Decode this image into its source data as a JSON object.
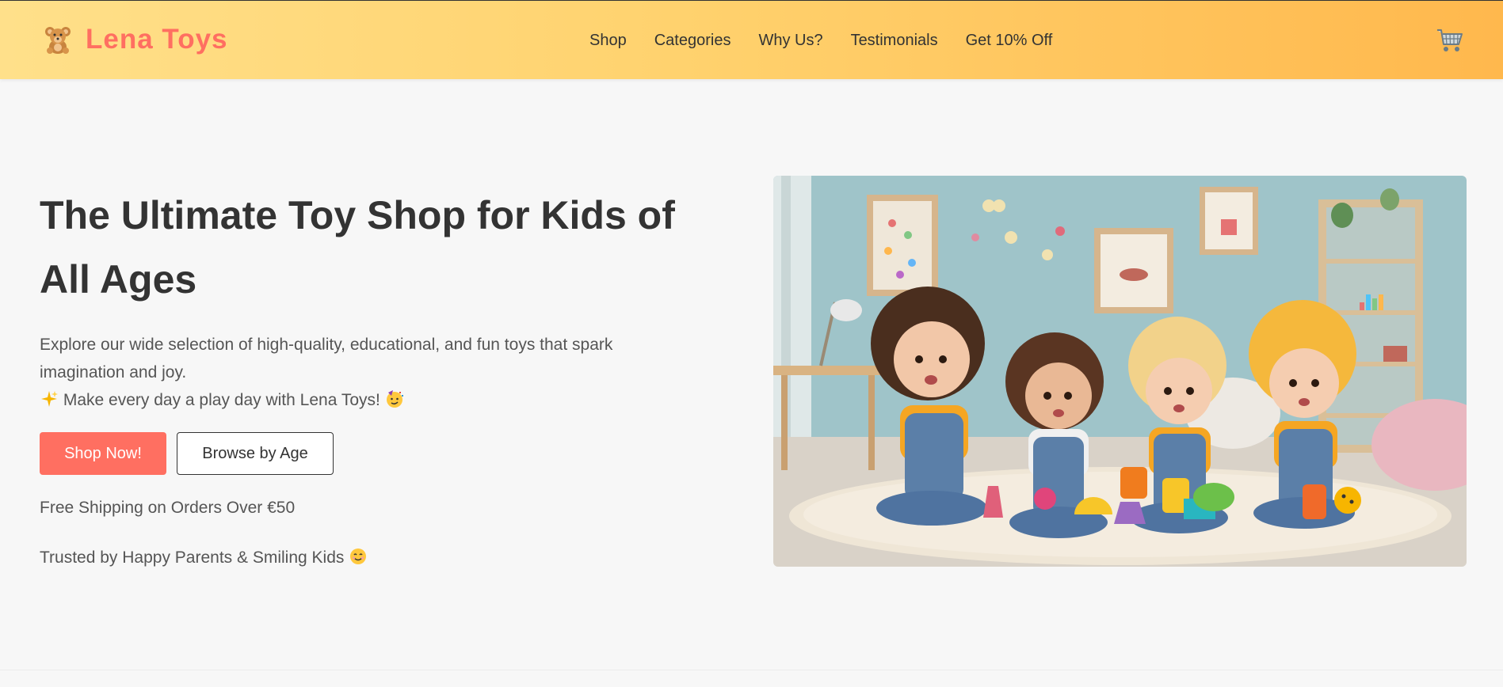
{
  "header": {
    "brand_name": "Lena Toys",
    "brand_icon": "teddy-bear-icon",
    "nav": [
      "Shop",
      "Categories",
      "Why Us?",
      "Testimonials",
      "Get 10% Off"
    ],
    "cart_icon": "cart-icon"
  },
  "hero": {
    "title_line1": "The Ultimate Toy Shop for Kids of",
    "title_line2": "All Ages",
    "desc_line1": "Explore our wide selection of high-quality, educational, and fun toys that spark",
    "desc_line2": "imagination and joy.",
    "tagline": "Make every day a play day with Lena Toys!",
    "shop_button": "Shop Now!",
    "browse_button": "Browse by Age",
    "shipping": "Free Shipping on Orders Over €50",
    "trusted": "Trusted by Happy Parents & Smiling Kids",
    "image_icon": "kids-playing-image"
  },
  "colors": {
    "accent": "#ff6f61",
    "header_start": "#ffe08a",
    "header_end": "#ffb84d",
    "background": "#f7f7f7"
  }
}
